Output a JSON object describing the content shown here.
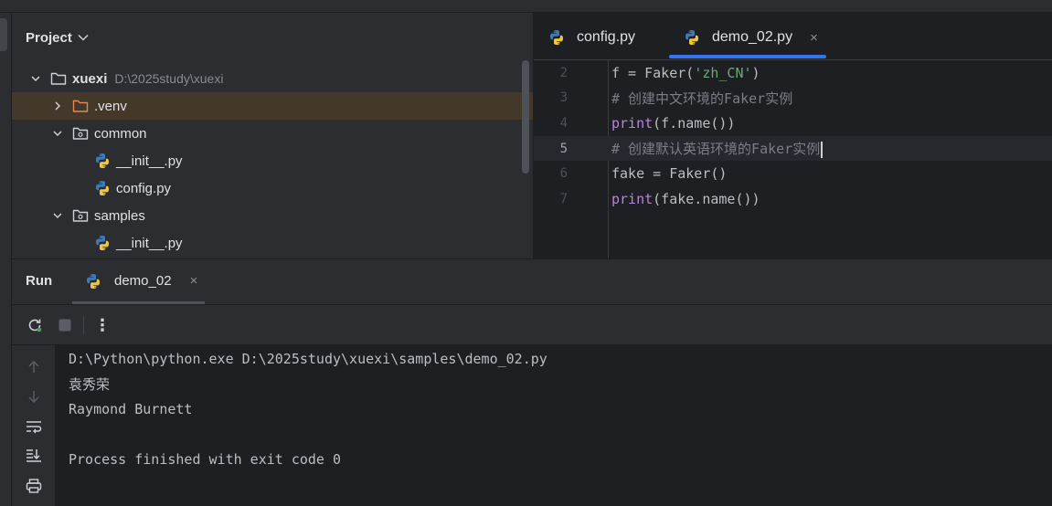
{
  "project": {
    "title": "Project",
    "tree": [
      {
        "indent": 0,
        "arrow": "down",
        "icon": "folder",
        "label": "xuexi",
        "bold": true,
        "hint": "D:\\2025study\\xuexi"
      },
      {
        "indent": 1,
        "arrow": "right",
        "icon": "folder-venv",
        "label": ".venv",
        "highlight": true
      },
      {
        "indent": 1,
        "arrow": "down",
        "icon": "package",
        "label": "common"
      },
      {
        "indent": 2,
        "arrow": "none",
        "icon": "python",
        "label": "__init__.py"
      },
      {
        "indent": 2,
        "arrow": "none",
        "icon": "python",
        "label": "config.py"
      },
      {
        "indent": 1,
        "arrow": "down",
        "icon": "package",
        "label": "samples"
      },
      {
        "indent": 2,
        "arrow": "none",
        "icon": "python",
        "label": "__init__.py"
      }
    ]
  },
  "editor": {
    "tabs": [
      {
        "label": "config.py",
        "active": false
      },
      {
        "label": "demo_02.py",
        "active": true,
        "close": "×"
      }
    ],
    "lines": [
      {
        "num": "2",
        "tokens": [
          {
            "t": "f = Faker(",
            "c": "plain"
          },
          {
            "t": "'zh_CN'",
            "c": "str"
          },
          {
            "t": ")",
            "c": "plain"
          }
        ]
      },
      {
        "num": "3",
        "tokens": [
          {
            "t": "# 创建中文环境的Faker实例",
            "c": "com"
          }
        ]
      },
      {
        "num": "4",
        "tokens": [
          {
            "t": "print",
            "c": "kw"
          },
          {
            "t": "(f.name())",
            "c": "plain"
          }
        ]
      },
      {
        "num": "5",
        "current": true,
        "tokens": [
          {
            "t": "# 创建默认英语环境的Faker实例",
            "c": "com"
          }
        ]
      },
      {
        "num": "6",
        "tokens": [
          {
            "t": "fake = Faker()",
            "c": "plain"
          }
        ]
      },
      {
        "num": "7",
        "tokens": [
          {
            "t": "print",
            "c": "kw"
          },
          {
            "t": "(fake.name())",
            "c": "plain"
          }
        ]
      }
    ]
  },
  "run": {
    "title": "Run",
    "tab_label": "demo_02",
    "tab_close": "×",
    "more_label": "⋮",
    "console": [
      "D:\\Python\\python.exe D:\\2025study\\xuexi\\samples\\demo_02.py",
      "袁秀荣",
      "Raymond Burnett",
      "",
      "Process finished with exit code 0"
    ]
  },
  "colors": {
    "accent": "#3574f0",
    "panel_bg": "#2b2d30",
    "editor_bg": "#1e1f22",
    "keyword": "#b784d9",
    "string": "#6aab73",
    "comment": "#7a7e85"
  }
}
